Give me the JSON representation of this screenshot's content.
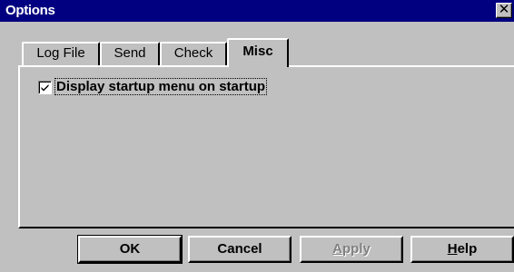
{
  "window": {
    "title": "Options",
    "close_glyph": "✕"
  },
  "tabs": [
    {
      "label": "Log File",
      "active": false
    },
    {
      "label": "Send",
      "active": false
    },
    {
      "label": "Check",
      "active": false
    },
    {
      "label": "Misc",
      "active": true
    }
  ],
  "misc": {
    "display_startup_menu": {
      "label": "Display startup menu on startup",
      "checked": true
    }
  },
  "buttons": {
    "ok": "OK",
    "cancel": "Cancel",
    "apply_accel": "A",
    "apply_rest": "pply",
    "apply_enabled": false,
    "help_accel": "H",
    "help_rest": "elp"
  },
  "colors": {
    "title_bar": "#000080",
    "face": "#c0c0c0",
    "disabled_text": "#808080"
  },
  "icons": {
    "close": "close-icon",
    "check": "checkmark-icon"
  }
}
